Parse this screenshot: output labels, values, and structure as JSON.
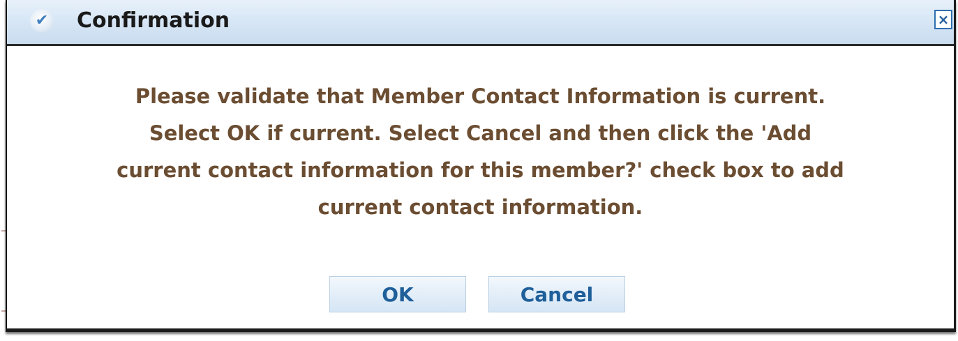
{
  "dialog": {
    "title": "Confirmation",
    "title_icon": "checkmark-icon",
    "close_symbol": "×",
    "message_lines": [
      "Please validate that Member Contact Information is current.",
      "Select OK if current. Select Cancel and then click the 'Add",
      "current contact information for this member?' check box to add",
      "current contact information."
    ],
    "buttons": {
      "ok_label": "OK",
      "cancel_label": "Cancel"
    }
  },
  "colors": {
    "message_text": "#6b4d32",
    "button_text": "#1f5f9a",
    "title_bar": "#d8e7f6",
    "check_icon": "#3d7fc0"
  }
}
